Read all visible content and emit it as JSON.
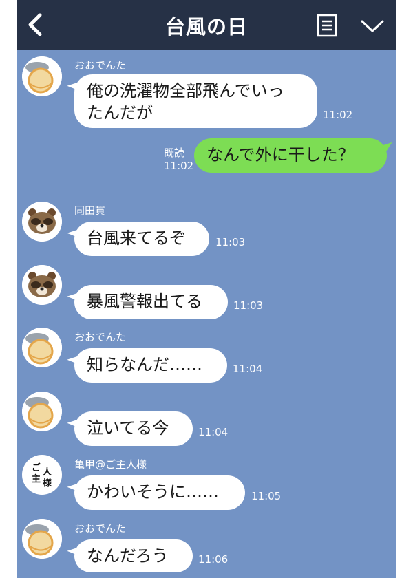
{
  "header": {
    "title": "台風の日",
    "back_icon": "chevron-left-icon",
    "menu_icon": "list-icon",
    "more_icon": "chevron-down-icon",
    "color": "#263146"
  },
  "chat": {
    "background": "#7393c5",
    "messages": [
      {
        "type": "incoming",
        "sender": "おおでんた",
        "text": "俺の洗濯物全部飛んでいっ\nたんだが",
        "time": "11:02"
      },
      {
        "type": "outgoing",
        "read_label": "既読",
        "text": "なんで外に干した？",
        "time": "11:02"
      },
      {
        "type": "incoming",
        "sender": "同田貫",
        "text": "台風来てるぞ",
        "time": "11:03"
      },
      {
        "type": "incoming",
        "sender": "",
        "text": "暴風警報出てる",
        "time": "11:03"
      },
      {
        "type": "incoming",
        "sender": "おおでんた",
        "text": "知らなんだ……",
        "time": "11:04"
      },
      {
        "type": "incoming",
        "sender": "",
        "text": "泣いてる今",
        "time": "11:04"
      },
      {
        "type": "incoming",
        "sender": "亀甲@ご主人様",
        "text": "かわいそうに……",
        "time": "11:05",
        "avatar_text": [
          "ご",
          "主",
          "人",
          "様"
        ]
      },
      {
        "type": "incoming",
        "sender": "おおでんた",
        "text": "なんだろう",
        "time": "11:06"
      }
    ]
  }
}
